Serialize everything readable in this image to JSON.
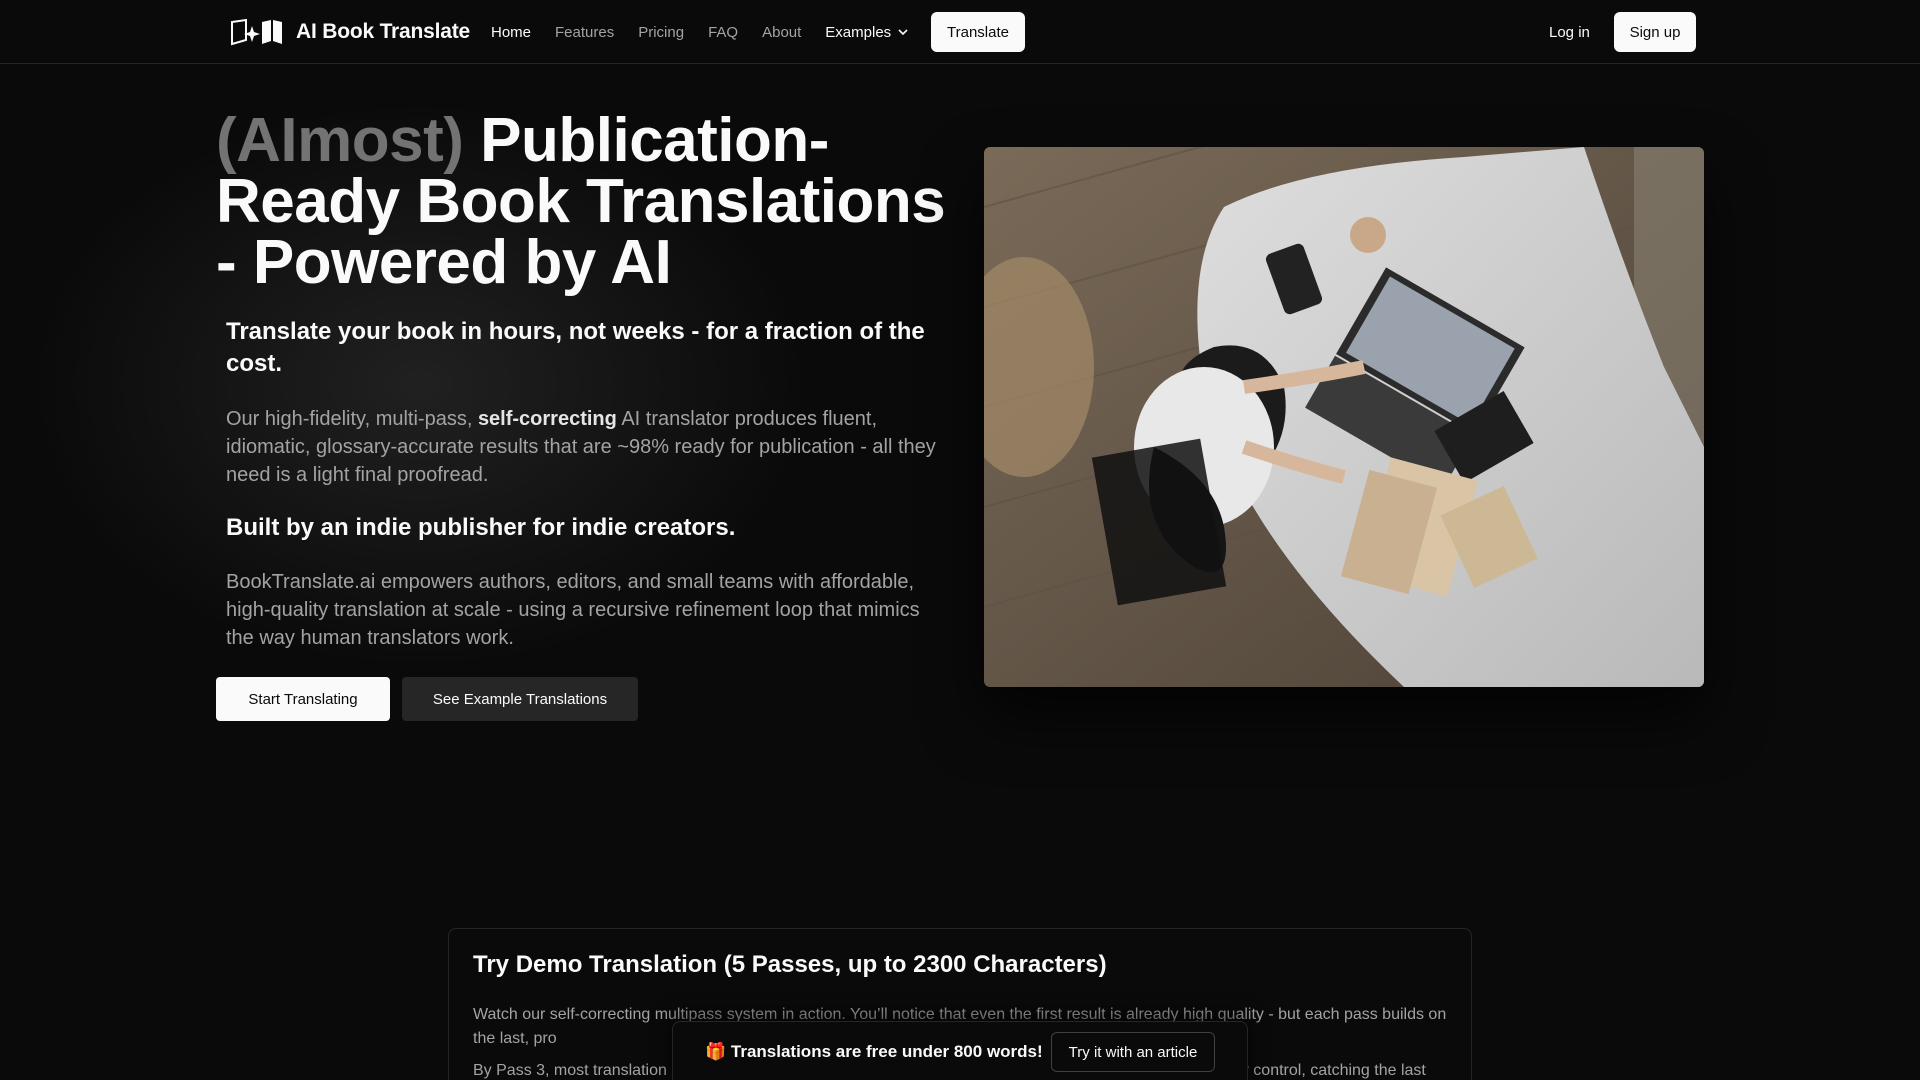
{
  "header": {
    "brand": "AI Book Translate",
    "nav": {
      "home": "Home",
      "features": "Features",
      "pricing": "Pricing",
      "faq": "FAQ",
      "about": "About",
      "examples": "Examples"
    },
    "translate_label": "Translate",
    "login_label": "Log in",
    "signup_label": "Sign up"
  },
  "hero": {
    "headline_muted": "(AImost)",
    "headline_main": " Publication-Ready Book Translations - Powered by AI",
    "subhead": "Translate your book in hours, not weeks - for a fraction of the cost.",
    "para1_before": "Our high-fidelity, multi-pass, ",
    "para1_bold": "self-correcting",
    "para1_after": " AI translator produces fluent, idiomatic, glossary-accurate results that are ~98% ready for publication - all they need is a light final proofread.",
    "h3": "Built by an indie publisher for indie creators.",
    "para2": "BookTranslate.ai empowers authors, editors, and small teams with affordable, high-quality translation at scale - using a recursive refinement loop that mimics the way human translators work.",
    "start_label": "Start Translating",
    "examples_label": "See Example Translations",
    "image_subject": "person-with-laptop-and-books-photo"
  },
  "demo": {
    "title": "Try Demo Translation (5 Passes, up to 2300 Characters)",
    "p1": "Watch our self-correcting multipass system in action. You’ll notice that even the first result is already high quality - but each pass builds on the last, pro",
    "p2_left": "By Pass 3, most translation",
    "p2_right": "y control, catching the last"
  },
  "banner": {
    "text": "🎁 Translations are free under 800 words!",
    "button_label": "Try it with an article"
  },
  "colors": {
    "background": "#0a0a0a",
    "foreground": "#fafafa",
    "muted": "#a3a3a3",
    "headline_muted": "#737373",
    "border": "#262626"
  }
}
